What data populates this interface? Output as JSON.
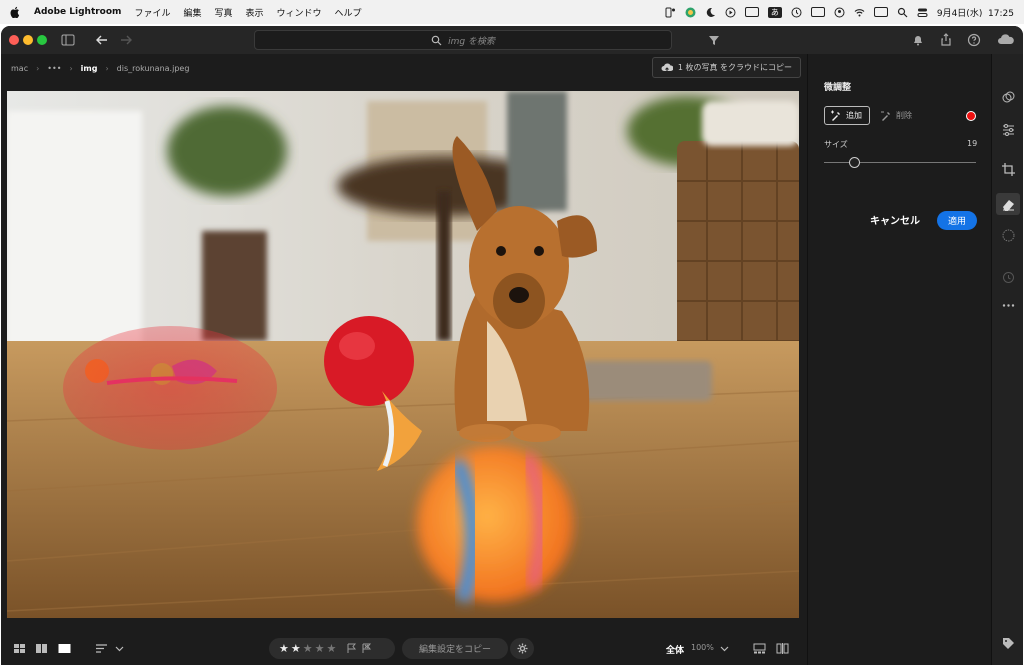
{
  "menubar": {
    "app_name": "Adobe Lightroom",
    "menus": [
      "ファイル",
      "編集",
      "写真",
      "表示",
      "ウィンドウ",
      "ヘルプ"
    ],
    "input_method": "あ",
    "datetime": "9月4日(水)  17:25"
  },
  "titlebar": {
    "search_placeholder": "img を検索"
  },
  "breadcrumb": {
    "items": [
      "mac",
      "•••",
      "img",
      "dis_rokunana.jpeg"
    ]
  },
  "copy_to_cloud": {
    "label": "1 枚の写真 をクラウドにコピー"
  },
  "panel": {
    "title": "微調整",
    "add_label": "追加",
    "remove_label": "削除",
    "size_label": "サイズ",
    "size_value": "19",
    "size_fraction": 0.2,
    "cancel_label": "キャンセル",
    "apply_label": "適用",
    "accent_color": "#1473e6",
    "record_color": "#e11111"
  },
  "bottombar": {
    "rating": 2,
    "rating_max": 5,
    "copy_settings_label": "編集設定をコピー",
    "fit_label": "全体",
    "zoom_label": "100%"
  },
  "photo": {
    "file": "dis_rokunana.jpeg",
    "brush_mask_color": "#e8323c"
  }
}
